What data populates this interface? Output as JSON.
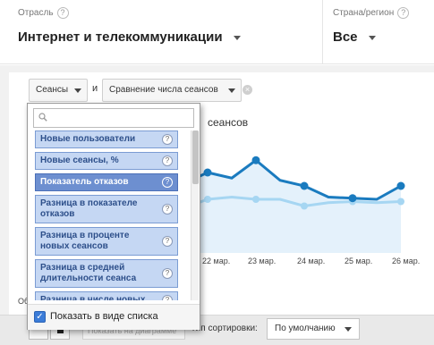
{
  "header": {
    "industry_label": "Отрасль",
    "industry_value": "Интернет и телекоммуникации",
    "region_label": "Страна/регион",
    "region_value": "Все",
    "help_glyph": "?"
  },
  "controls": {
    "metric1": "Сеансы",
    "and_label": "и",
    "metric2": "Сравнение числа сеансов",
    "clear_glyph": "×"
  },
  "chart": {
    "title": "сеансов",
    "x_ticks": [
      "22 мар.",
      "23 мар.",
      "24 мар.",
      "25 мар.",
      "26 мар."
    ]
  },
  "chart_data": {
    "type": "line",
    "x": [
      "22 мар.",
      "",
      "23 мар.",
      "",
      "24 мар.",
      "",
      "25 мар.",
      "",
      "26 мар.",
      ""
    ],
    "series": [
      {
        "values": [
          62,
          72,
          67,
          83,
          65,
          60,
          50,
          49,
          48,
          60
        ],
        "color": "#1a7bbf"
      },
      {
        "values": [
          40,
          48,
          50,
          48,
          48,
          42,
          45,
          46,
          45,
          46
        ],
        "color": "#a6d6f2"
      }
    ],
    "colors": {
      "area_fill": "#e4f1fb"
    }
  },
  "dropdown": {
    "search_placeholder": "",
    "items": [
      {
        "label": "Новые пользователи",
        "selected": false
      },
      {
        "label": "Новые сеансы, %",
        "selected": false
      },
      {
        "label": "Показатель отказов",
        "selected": true
      },
      {
        "label": "Разница в показателе отказов",
        "selected": false
      },
      {
        "label": "Разница в проценте новых сеансов",
        "selected": false
      },
      {
        "label": "Разница в средней длительности сеанса",
        "selected": false
      },
      {
        "label": "Разница в числе новых",
        "selected": false
      }
    ],
    "help_glyph": "?",
    "show_as_list_label": "Показать в виде списка",
    "show_as_list_checked": true
  },
  "bottom": {
    "ob_label": "Об",
    "ghost_button": "Показать на диаграмме",
    "sort_label": "Тип сортировки:",
    "sort_value": "По умолчанию"
  },
  "colors": {
    "accent": "#1a7bbf",
    "item_bg": "#c5d7f3",
    "item_selected_bg": "#6d8fd0"
  }
}
